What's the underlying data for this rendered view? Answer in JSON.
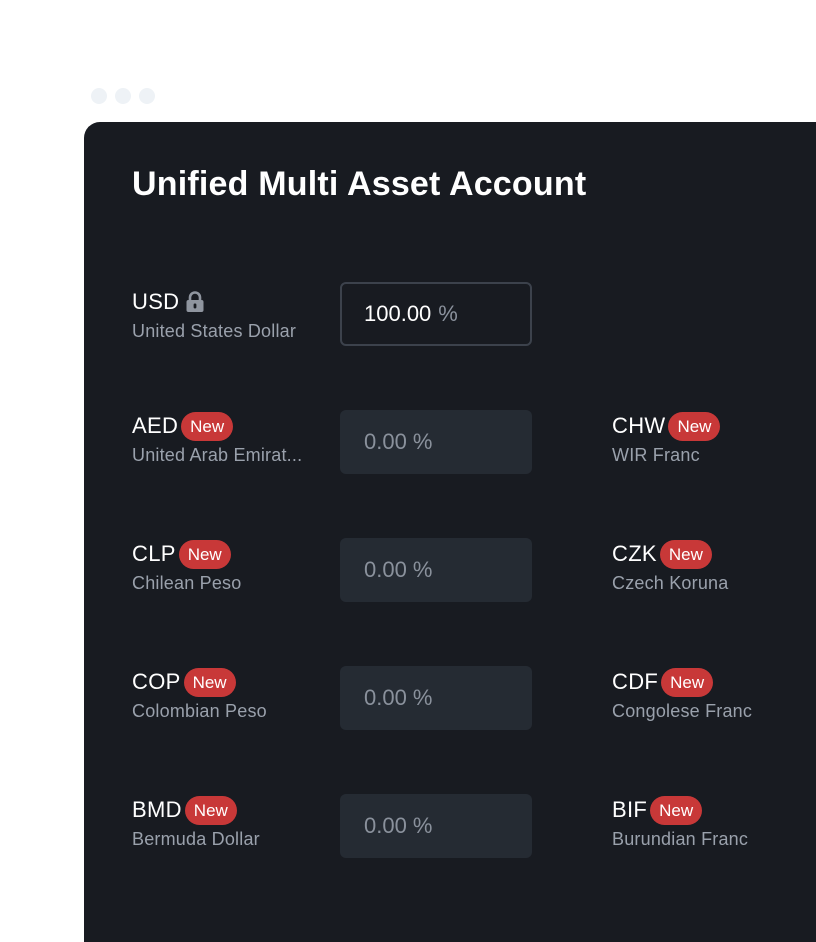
{
  "title": "Unified Multi Asset Account",
  "base": {
    "code": "USD",
    "name": "United States Dollar",
    "value": "100.00",
    "unit": "%",
    "icon": "lock-icon"
  },
  "badge_label": "New",
  "rows": [
    {
      "left": {
        "code": "AED",
        "name": "United Arab Emirat...",
        "value": "0.00 %"
      },
      "right": {
        "code": "CHW",
        "name": "WIR Franc"
      }
    },
    {
      "left": {
        "code": "CLP",
        "name": "Chilean Peso",
        "value": "0.00 %"
      },
      "right": {
        "code": "CZK",
        "name": "Czech Koruna"
      }
    },
    {
      "left": {
        "code": "COP",
        "name": "Colombian Peso",
        "value": "0.00 %"
      },
      "right": {
        "code": "CDF",
        "name": "Congolese Franc"
      }
    },
    {
      "left": {
        "code": "BMD",
        "name": "Bermuda Dollar",
        "value": "0.00 %"
      },
      "right": {
        "code": "BIF",
        "name": "Burundian Franc"
      }
    }
  ],
  "colors": {
    "panel_bg": "#181b21",
    "badge_bg": "#c83838",
    "input_bg": "#252b33",
    "secondary_text": "#9aa1ac"
  }
}
